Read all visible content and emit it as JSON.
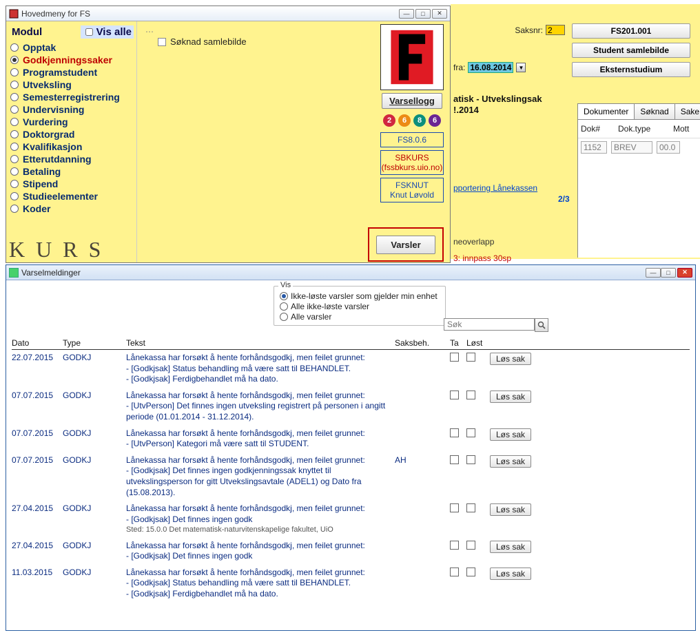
{
  "fs_window": {
    "title": "Hovedmeny for FS",
    "modul_label": "Modul",
    "vis_alle": "Vis alle",
    "modules": [
      {
        "label": "Opptak",
        "selected": false
      },
      {
        "label": "Godkjenningssaker",
        "selected": true
      },
      {
        "label": "Programstudent",
        "selected": false
      },
      {
        "label": "Utveksling",
        "selected": false
      },
      {
        "label": "Semesterregistrering",
        "selected": false
      },
      {
        "label": "Undervisning",
        "selected": false
      },
      {
        "label": "Vurdering",
        "selected": false
      },
      {
        "label": "Doktorgrad",
        "selected": false
      },
      {
        "label": "Kvalifikasjon",
        "selected": false
      },
      {
        "label": "Etterutdanning",
        "selected": false
      },
      {
        "label": "Betaling",
        "selected": false
      },
      {
        "label": "Stipend",
        "selected": false
      },
      {
        "label": "Studieelementer",
        "selected": false
      },
      {
        "label": "Koder",
        "selected": false
      }
    ],
    "tree_item": "Søknad samlebilde",
    "kurs_text": "K U R S",
    "varsellogg_btn": "Varsellogg",
    "versions": [
      "2",
      "6",
      "8",
      "6"
    ],
    "version_colors": [
      "#d1283f",
      "#ec8b14",
      "#0c8f7c",
      "#6b2593"
    ],
    "box_version": "FS8.0.6",
    "box_server": "SBKURS",
    "box_server_url": "(fssbkurs.uio.no)",
    "box_user": "FSKNUT",
    "box_user_name": "Knut Løvold",
    "varsler_btn": "Varsler"
  },
  "right_strip": {
    "saksnr_lbl": "Saksnr:",
    "saksnr_val": "2",
    "btn_fs201": "FS201.001",
    "btn_student": "Student samlebilde",
    "btn_ekstern": "Eksternstudium",
    "fra_lbl": "fra:",
    "fra_date": "16.08.2014",
    "sak_line": "atisk - Utvekslingsak",
    "sak_line2": "!.2014",
    "rap_link": "pportering Lånekassen",
    "counter": "2/3",
    "overlapp_lbl": "neoverlapp",
    "innpass_txt": "3: innpass 30sp",
    "tabs": [
      "Dokumenter",
      "Søknad",
      "Sake"
    ],
    "doc_headers": [
      "Dok#",
      "Dok.type",
      "Mott"
    ],
    "doc_row": [
      "1152",
      "BREV",
      "00.0"
    ]
  },
  "vm_window": {
    "title": "Varselmeldinger",
    "vis_label": "Vis",
    "vis_options": [
      {
        "label": "Ikke-løste varsler som gjelder min enhet",
        "selected": true
      },
      {
        "label": "Alle ikke-løste varsler",
        "selected": false
      },
      {
        "label": "Alle varsler",
        "selected": false
      }
    ],
    "search_placeholder": "Søk",
    "headers": {
      "dato": "Dato",
      "type": "Type",
      "tekst": "Tekst",
      "saksbeh": "Saksbeh.",
      "ta": "Ta",
      "lost": "Løst"
    },
    "solve_btn": "Løs sak",
    "rows": [
      {
        "dato": "22.07.2015",
        "type": "GODKJ",
        "tekst": "Lånekassa har forsøkt å hente forhåndsgodkj, men feilet grunnet:\n- [Godkjsak] Status behandling må være satt til BEHANDLET.\n- [Godkjsak] Ferdigbehandlet må ha dato.",
        "sb": ""
      },
      {
        "dato": "07.07.2015",
        "type": "GODKJ",
        "tekst": "Lånekassa har forsøkt å hente forhåndsgodkj, men feilet grunnet:\n- [UtvPerson] Det finnes ingen utveksling registrert på personen i angitt periode (01.01.2014 - 31.12.2014).",
        "sb": ""
      },
      {
        "dato": "07.07.2015",
        "type": "GODKJ",
        "tekst": "Lånekassa har forsøkt å hente forhåndsgodkj, men feilet grunnet:\n- [UtvPerson] Kategori må være satt til STUDENT.",
        "sb": ""
      },
      {
        "dato": "07.07.2015",
        "type": "GODKJ",
        "tekst": "Lånekassa har forsøkt å hente forhåndsgodkj, men feilet grunnet:\n- [Godkjsak] Det finnes ingen godkjenningssak knyttet til utvekslingsperson for gitt Utvekslingsavtale (ADEL1) og Dato fra (15.08.2013).",
        "sb": "AH"
      },
      {
        "dato": "27.04.2015",
        "type": "GODKJ",
        "tekst": "Lånekassa har forsøkt å hente forhåndsgodkj, men feilet grunnet:\n- [Godkjsak] Det finnes ingen godk",
        "sb": "",
        "note": "Sted: 15.0.0 Det matematisk-naturvitenskapelige fakultet, UiO"
      },
      {
        "dato": "27.04.2015",
        "type": "GODKJ",
        "tekst": "Lånekassa har forsøkt å hente forhåndsgodkj, men feilet grunnet:\n- [Godkjsak] Det finnes ingen godk",
        "sb": ""
      },
      {
        "dato": "11.03.2015",
        "type": "GODKJ",
        "tekst": "Lånekassa har forsøkt å hente forhåndsgodkj, men feilet grunnet:\n- [Godkjsak] Status behandling må være satt til BEHANDLET.\n- [Godkjsak] Ferdigbehandlet må ha dato.",
        "sb": ""
      }
    ]
  }
}
